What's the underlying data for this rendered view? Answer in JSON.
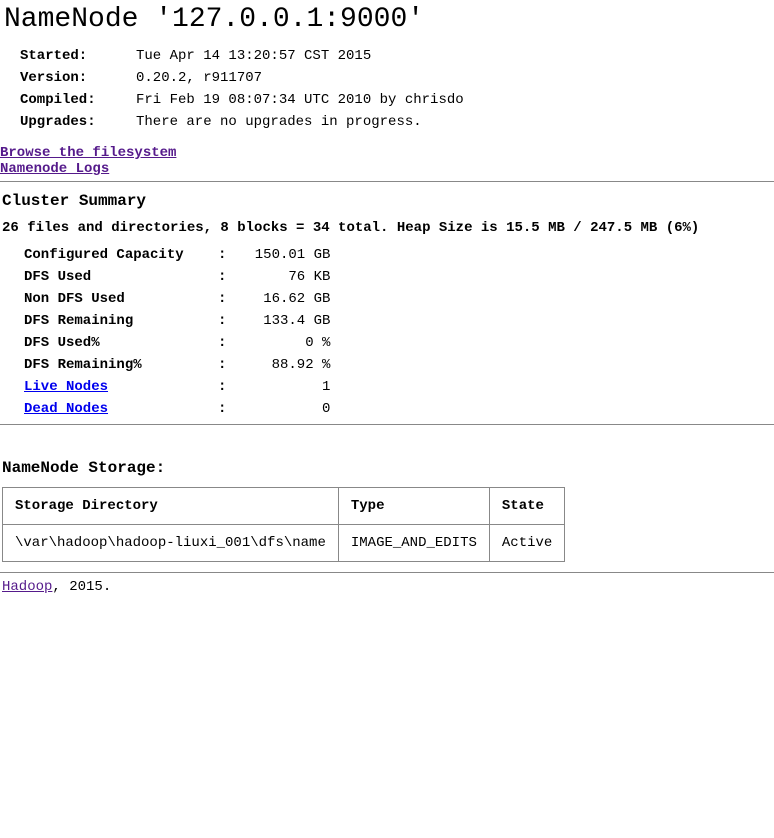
{
  "title": "NameNode '127.0.0.1:9000'",
  "info": {
    "started_label": "Started:",
    "started_value": "Tue Apr 14 13:20:57 CST 2015",
    "version_label": "Version:",
    "version_value": "0.20.2, r911707",
    "compiled_label": "Compiled:",
    "compiled_value": "Fri Feb 19 08:07:34 UTC 2010 by chrisdo",
    "upgrades_label": "Upgrades:",
    "upgrades_value": "There are no upgrades in progress."
  },
  "links": {
    "browse_fs": "Browse the filesystem",
    "namenode_logs": "Namenode Logs"
  },
  "cluster": {
    "heading": "Cluster Summary",
    "summary": "26 files and directories, 8 blocks = 34 total. Heap Size is 15.5 MB / 247.5 MB (6%)",
    "rows": {
      "configured_capacity_label": "Configured Capacity",
      "configured_capacity_value": "150.01 GB",
      "dfs_used_label": "DFS Used",
      "dfs_used_value": "76 KB",
      "non_dfs_used_label": "Non DFS Used",
      "non_dfs_used_value": "16.62 GB",
      "dfs_remaining_label": "DFS Remaining",
      "dfs_remaining_value": "133.4 GB",
      "dfs_used_pct_label": "DFS Used%",
      "dfs_used_pct_value": "0 %",
      "dfs_remaining_pct_label": "DFS Remaining%",
      "dfs_remaining_pct_value": "88.92 %",
      "live_nodes_label": "Live Nodes",
      "live_nodes_value": "1",
      "dead_nodes_label": "Dead Nodes",
      "dead_nodes_value": "0"
    }
  },
  "storage": {
    "heading": "NameNode Storage:",
    "headers": {
      "dir": "Storage Directory",
      "type": "Type",
      "state": "State"
    },
    "row": {
      "dir": "\\var\\hadoop\\hadoop-liuxi_001\\dfs\\name",
      "type": "IMAGE_AND_EDITS",
      "state": "Active"
    }
  },
  "footer": {
    "hadoop_link": "Hadoop",
    "year": ", 2015."
  }
}
